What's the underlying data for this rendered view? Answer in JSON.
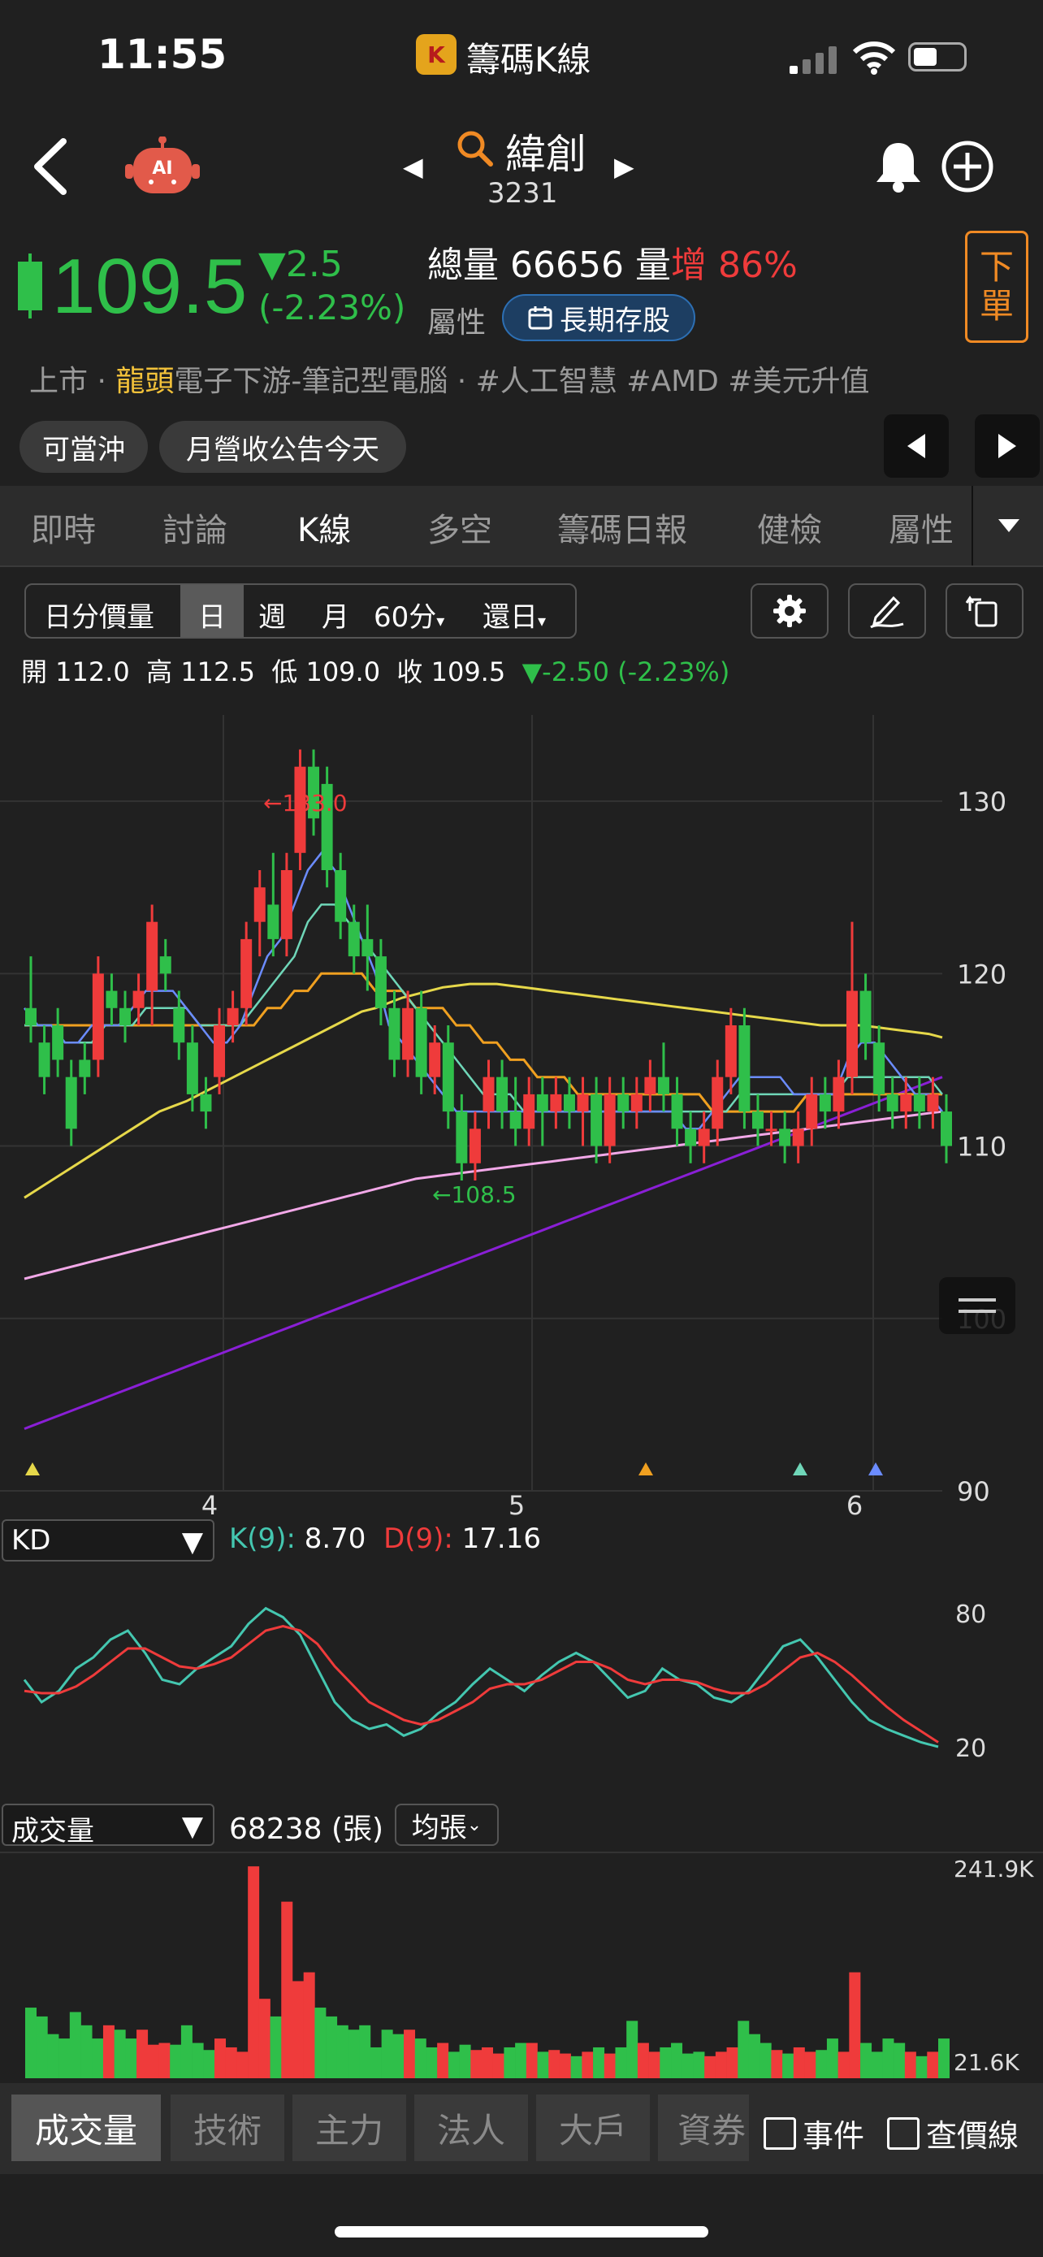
{
  "status": {
    "time": "11:55",
    "app_title": "籌碼K線"
  },
  "stock": {
    "name": "緯創",
    "code": "3231"
  },
  "quote": {
    "price": "109.5",
    "change": "▼2.5",
    "change_pct": "(-2.23%)",
    "volume_label": "總量",
    "volume": "66656",
    "vol_unit": "量",
    "vol_up_label": "增",
    "vol_up_pct": "86%",
    "attr_label": "屬性",
    "attr_tag": "長期存股",
    "order_label_1": "下",
    "order_label_2": "單"
  },
  "tags": {
    "prefix": "上市 · ",
    "leader": "龍頭",
    "rest": "電子下游-筆記型電腦 · #人工智慧  #AMD  #美元升值"
  },
  "chips": [
    "可當沖",
    "月營收公告今天"
  ],
  "tabs": [
    "即時",
    "討論",
    "K線",
    "多空",
    "籌碼日報",
    "健檢",
    "屬性"
  ],
  "active_tab": "K線",
  "periods": [
    "日分價量",
    "日",
    "週",
    "月",
    "60分",
    "還日"
  ],
  "ohlc": {
    "open": "開 112.0",
    "high": "高 112.5",
    "low": "低 109.0",
    "close": "收 109.5",
    "change": "▼-2.50 (-2.23%)"
  },
  "chart_data": [
    {
      "type": "candlestick",
      "title": "",
      "y_ticks": [
        "130",
        "120",
        "110",
        "100",
        "90"
      ],
      "x_ticks": [
        "4",
        "5",
        "6"
      ],
      "ylim": [
        90,
        135
      ],
      "annotations": [
        "133.0",
        "108.5"
      ],
      "candles": [
        [
          118,
          121,
          116,
          117
        ],
        [
          116,
          117,
          113,
          114
        ],
        [
          117,
          118,
          114,
          115
        ],
        [
          114,
          115,
          110,
          111
        ],
        [
          115,
          116,
          113,
          114
        ],
        [
          115,
          121,
          114,
          120
        ],
        [
          119,
          120,
          117,
          118
        ],
        [
          118,
          119,
          116,
          117
        ],
        [
          118,
          120,
          117,
          119
        ],
        [
          119,
          124,
          117,
          123
        ],
        [
          121,
          122,
          119,
          120
        ],
        [
          118,
          119,
          115,
          116
        ],
        [
          116,
          117,
          112,
          113
        ],
        [
          113,
          114,
          111,
          112
        ],
        [
          114,
          118,
          113,
          117
        ],
        [
          117,
          119,
          116,
          118
        ],
        [
          118,
          123,
          117,
          122
        ],
        [
          123,
          126,
          121,
          125
        ],
        [
          124,
          127,
          121,
          122
        ],
        [
          122,
          127,
          121,
          126
        ],
        [
          127,
          133,
          126,
          132
        ],
        [
          132,
          133,
          128,
          129
        ],
        [
          131,
          132,
          125,
          126
        ],
        [
          126,
          127,
          122,
          123
        ],
        [
          123,
          124,
          120,
          121
        ],
        [
          122,
          124,
          119,
          121
        ],
        [
          121,
          122,
          117,
          118
        ],
        [
          118,
          119,
          114,
          115
        ],
        [
          115,
          119,
          114,
          118
        ],
        [
          118,
          119,
          113,
          114
        ],
        [
          114,
          117,
          113,
          116
        ],
        [
          116,
          117,
          111,
          112
        ],
        [
          112,
          113,
          108,
          109
        ],
        [
          109,
          112,
          108,
          111
        ],
        [
          112,
          115,
          111,
          114
        ],
        [
          114,
          115,
          111,
          112
        ],
        [
          112,
          114,
          110,
          111
        ],
        [
          111,
          114,
          110,
          113
        ],
        [
          113,
          114,
          110,
          112
        ],
        [
          112,
          114,
          111,
          113
        ],
        [
          113,
          114,
          111,
          112
        ],
        [
          112,
          114,
          110,
          113
        ],
        [
          113,
          114,
          109,
          110
        ],
        [
          110,
          114,
          109,
          113
        ],
        [
          113,
          114,
          111,
          112
        ],
        [
          112,
          114,
          111,
          113
        ],
        [
          113,
          115,
          112,
          114
        ],
        [
          114,
          116,
          112,
          113
        ],
        [
          113,
          114,
          110,
          111
        ],
        [
          111,
          112,
          109,
          110
        ],
        [
          110,
          112,
          109,
          111
        ],
        [
          111,
          115,
          110,
          114
        ],
        [
          114,
          118,
          113,
          117
        ],
        [
          117,
          118,
          111,
          112
        ],
        [
          112,
          113,
          110,
          111
        ],
        [
          111,
          112,
          110,
          111
        ],
        [
          111,
          112,
          109,
          110
        ],
        [
          110,
          112,
          109,
          111
        ],
        [
          111,
          114,
          110,
          113
        ],
        [
          113,
          114,
          111,
          112
        ],
        [
          112,
          115,
          111,
          114
        ],
        [
          114,
          123,
          113,
          119
        ],
        [
          119,
          120,
          115,
          116
        ],
        [
          116,
          117,
          112,
          113
        ],
        [
          113,
          114,
          111,
          112
        ],
        [
          112,
          114,
          111,
          113
        ],
        [
          113,
          114,
          111,
          112
        ],
        [
          112,
          114,
          111,
          113
        ],
        [
          112,
          113,
          109,
          110
        ]
      ],
      "ma5": [
        118,
        117,
        117,
        116,
        116,
        117,
        117,
        117,
        118,
        119,
        119,
        119,
        118,
        117,
        116,
        116,
        117,
        119,
        121,
        122,
        124,
        126,
        127,
        126,
        124,
        122,
        120,
        117,
        116,
        115,
        114,
        113,
        112,
        112,
        112,
        112,
        112,
        112,
        112,
        112,
        112,
        112,
        112,
        112,
        112,
        112,
        112,
        112,
        112,
        111,
        111,
        112,
        113,
        114,
        114,
        114,
        114,
        113,
        113,
        113,
        113,
        115,
        116,
        116,
        115,
        114,
        113,
        113,
        112
      ],
      "ma10": [
        117,
        117,
        117,
        116,
        116,
        116,
        117,
        117,
        117,
        118,
        118,
        118,
        118,
        117,
        117,
        117,
        117,
        118,
        119,
        120,
        121,
        123,
        124,
        124,
        123,
        122,
        121,
        120,
        119,
        118,
        117,
        116,
        115,
        114,
        113,
        113,
        113,
        112,
        112,
        112,
        112,
        112,
        112,
        112,
        112,
        112,
        112,
        112,
        112,
        112,
        112,
        112,
        112,
        113,
        113,
        113,
        113,
        113,
        113,
        113,
        113,
        114,
        114,
        114,
        114,
        114,
        114,
        114,
        113
      ],
      "ma20": [
        117,
        117,
        117,
        117,
        117,
        117,
        117,
        117,
        117,
        117,
        117,
        117,
        117,
        117,
        117,
        117,
        117,
        117,
        118,
        118,
        119,
        119,
        120,
        120,
        120,
        120,
        119,
        119,
        119,
        118,
        118,
        118,
        117,
        117,
        116,
        116,
        115,
        115,
        114,
        114,
        114,
        113,
        113,
        113,
        113,
        113,
        113,
        113,
        113,
        113,
        113,
        112,
        112,
        112,
        112,
        112,
        112,
        112,
        113,
        113,
        113,
        113,
        113,
        113,
        113,
        113,
        113,
        113,
        113
      ],
      "ma60": [
        107,
        107.5,
        108,
        108.5,
        109,
        109.5,
        110,
        110.5,
        111,
        111.5,
        112,
        112.3,
        112.6,
        113,
        113.4,
        113.8,
        114.2,
        114.6,
        115,
        115.4,
        115.8,
        116.2,
        116.6,
        117,
        117.4,
        117.8,
        118,
        118.3,
        118.6,
        118.8,
        119,
        119.2,
        119.3,
        119.4,
        119.4,
        119.4,
        119.3,
        119.2,
        119.1,
        119,
        118.9,
        118.8,
        118.7,
        118.6,
        118.5,
        118.4,
        118.3,
        118.2,
        118.1,
        118,
        117.9,
        117.8,
        117.7,
        117.6,
        117.5,
        117.4,
        117.3,
        117.2,
        117.1,
        117,
        117,
        117,
        117,
        116.9,
        116.8,
        116.7,
        116.6,
        116.5,
        116.3
      ],
      "ma120": [
        102.3,
        102.5,
        102.7,
        102.9,
        103.1,
        103.3,
        103.5,
        103.7,
        103.9,
        104.1,
        104.3,
        104.5,
        104.7,
        104.9,
        105.1,
        105.3,
        105.5,
        105.7,
        105.9,
        106.1,
        106.3,
        106.5,
        106.7,
        106.9,
        107.1,
        107.3,
        107.5,
        107.7,
        107.9,
        108.1,
        108.2,
        108.3,
        108.4,
        108.5,
        108.6,
        108.7,
        108.8,
        108.9,
        109,
        109.1,
        109.2,
        109.3,
        109.4,
        109.5,
        109.6,
        109.7,
        109.8,
        109.9,
        110,
        110.1,
        110.2,
        110.3,
        110.4,
        110.5,
        110.6,
        110.7,
        110.8,
        110.9,
        111,
        111.1,
        111.2,
        111.3,
        111.4,
        111.5,
        111.6,
        111.7,
        111.8,
        111.9,
        112
      ],
      "ma240": [
        93.6,
        93.9,
        94.2,
        94.5,
        94.8,
        95.1,
        95.4,
        95.7,
        96,
        96.3,
        96.6,
        96.9,
        97.2,
        97.5,
        97.8,
        98.1,
        98.4,
        98.7,
        99,
        99.3,
        99.6,
        99.9,
        100.2,
        100.5,
        100.8,
        101.1,
        101.4,
        101.7,
        102,
        102.3,
        102.6,
        102.9,
        103.2,
        103.5,
        103.8,
        104.1,
        104.4,
        104.7,
        105,
        105.3,
        105.6,
        105.9,
        106.2,
        106.5,
        106.8,
        107.1,
        107.4,
        107.7,
        108,
        108.3,
        108.6,
        108.9,
        109.2,
        109.5,
        109.8,
        110.1,
        110.4,
        110.7,
        111,
        111.3,
        111.6,
        111.9,
        112.2,
        112.5,
        112.8,
        113.1,
        113.4,
        113.7,
        114
      ]
    },
    {
      "type": "line",
      "title": "KD",
      "y_ticks": [
        "80",
        "20"
      ],
      "ylim": [
        0,
        100
      ],
      "series": [
        {
          "name": "K(9):",
          "value_label": "8.70",
          "values": [
            50,
            40,
            45,
            55,
            60,
            68,
            72,
            62,
            50,
            48,
            55,
            60,
            65,
            75,
            82,
            78,
            70,
            55,
            40,
            32,
            28,
            30,
            25,
            28,
            35,
            40,
            48,
            55,
            50,
            45,
            52,
            58,
            62,
            58,
            50,
            42,
            45,
            55,
            50,
            48,
            42,
            40,
            45,
            55,
            65,
            68,
            60,
            50,
            40,
            32,
            28,
            25,
            22,
            20
          ]
        },
        {
          "name": "D(9):",
          "value_label": "17.16",
          "values": [
            45,
            44,
            44,
            47,
            52,
            58,
            64,
            64,
            60,
            56,
            55,
            57,
            60,
            66,
            72,
            74,
            72,
            66,
            56,
            48,
            40,
            36,
            32,
            30,
            32,
            36,
            40,
            46,
            48,
            48,
            50,
            54,
            58,
            58,
            55,
            50,
            48,
            50,
            50,
            49,
            46,
            44,
            44,
            48,
            54,
            60,
            62,
            58,
            52,
            45,
            38,
            32,
            27,
            22
          ]
        }
      ]
    },
    {
      "type": "bar",
      "title": "成交量",
      "y_ticks": [
        "241.9K",
        "21.6K"
      ],
      "value_label": "68238 (張)",
      "values": [
        80,
        70,
        50,
        45,
        75,
        60,
        45,
        60,
        55,
        45,
        55,
        38,
        40,
        38,
        60,
        40,
        32,
        45,
        35,
        30,
        240,
        90,
        70,
        200,
        110,
        120,
        80,
        70,
        60,
        55,
        60,
        35,
        55,
        50,
        55,
        45,
        35,
        40,
        30,
        38,
        32,
        35,
        28,
        35,
        40,
        40,
        30,
        32,
        28,
        25,
        30,
        35,
        28,
        35,
        65,
        40,
        30,
        35,
        40,
        28,
        30,
        25,
        30,
        35,
        65,
        50,
        40,
        32,
        28,
        35,
        30,
        32,
        45,
        30,
        120,
        40,
        30,
        45,
        40,
        30,
        25,
        30,
        45
      ]
    }
  ],
  "kd_select": "KD",
  "vol_select": "成交量",
  "vol_avg_btn": "均張",
  "bottom_tabs": [
    "成交量",
    "技術",
    "主力",
    "法人",
    "大戶",
    "資券"
  ],
  "checks": [
    "事件",
    "查價線"
  ],
  "colors": {
    "up": "#ef3b3b",
    "down": "#2fbf4a",
    "accent": "#f08a24",
    "tag_blue": "#2d6fb3"
  }
}
